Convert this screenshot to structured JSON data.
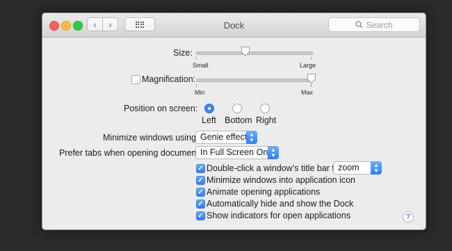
{
  "window": {
    "title": "Dock",
    "search_placeholder": "Search"
  },
  "size": {
    "label": "Size:",
    "min_label": "Small",
    "max_label": "Large",
    "value_fraction": 0.43
  },
  "magnification": {
    "label": "Magnification:",
    "checked": false,
    "min_label": "Min",
    "max_label": "Max",
    "value_fraction": 1.0
  },
  "position": {
    "label": "Position on screen:",
    "options": [
      "Left",
      "Bottom",
      "Right"
    ],
    "selected": "Left"
  },
  "minimize": {
    "label": "Minimize windows using:",
    "value": "Genie effect"
  },
  "prefer_tabs": {
    "label": "Prefer tabs when opening documents:",
    "value": "In Full Screen Only"
  },
  "checkboxes": [
    {
      "label": "Double-click a window’s title bar to",
      "checked": true
    },
    {
      "label": "Minimize windows into application icon",
      "checked": true
    },
    {
      "label": "Animate opening applications",
      "checked": true
    },
    {
      "label": "Automatically hide and show the Dock",
      "checked": true
    },
    {
      "label": "Show indicators for open applications",
      "checked": true
    }
  ],
  "double_click_action": "zoom",
  "help_label": "?",
  "colors": {
    "accent": "#3d86f5",
    "close": "#fc605c",
    "minimize": "#fdbc40",
    "zoom": "#34c84a"
  }
}
